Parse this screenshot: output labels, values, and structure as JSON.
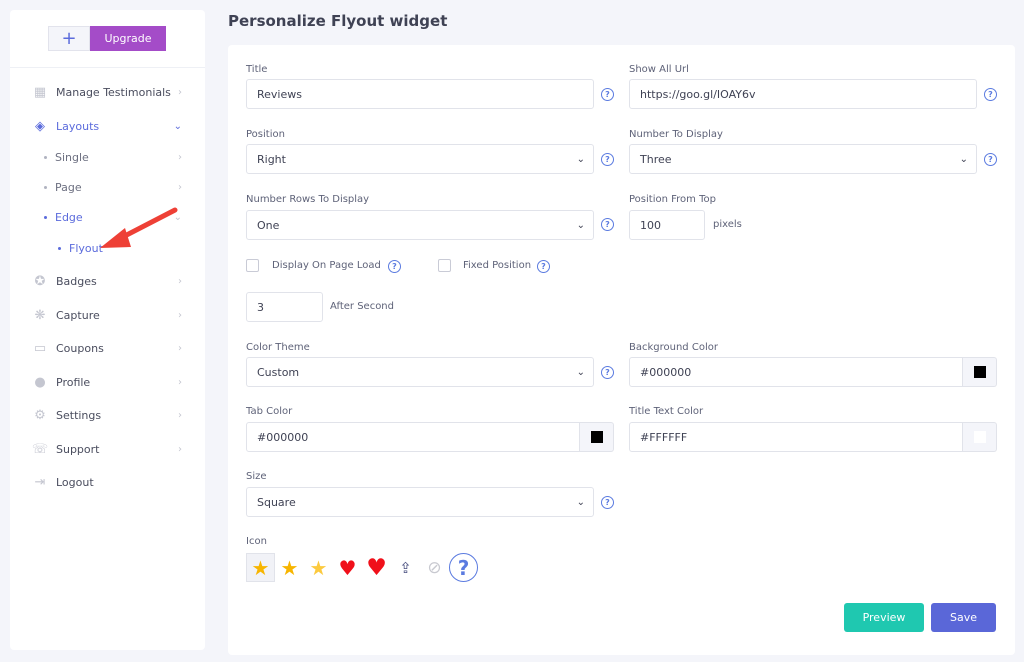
{
  "sidebar": {
    "plus_label": "+",
    "upgrade_label": "Upgrade",
    "items": [
      {
        "label": "Manage Testimonials",
        "icon": "grid-icon"
      },
      {
        "label": "Layouts",
        "icon": "layers-icon"
      },
      {
        "label": "Badges",
        "icon": "badge-icon"
      },
      {
        "label": "Capture",
        "icon": "capture-icon"
      },
      {
        "label": "Coupons",
        "icon": "coupon-icon"
      },
      {
        "label": "Profile",
        "icon": "user-icon"
      },
      {
        "label": "Settings",
        "icon": "gear-icon"
      },
      {
        "label": "Support",
        "icon": "support-icon"
      },
      {
        "label": "Logout",
        "icon": "logout-icon"
      }
    ],
    "subitems": [
      {
        "label": "Single"
      },
      {
        "label": "Page"
      },
      {
        "label": "Edge"
      },
      {
        "label": "Flyout"
      }
    ],
    "accent": "#5b6bdc"
  },
  "page_title": "Personalize Flyout widget",
  "form": {
    "title": {
      "label": "Title",
      "value": "Reviews"
    },
    "show_all_url": {
      "label": "Show All Url",
      "value": "https://goo.gl/IOAY6v"
    },
    "position": {
      "label": "Position",
      "value": "Right"
    },
    "number_to_display": {
      "label": "Number To Display",
      "value": "Three"
    },
    "number_rows": {
      "label": "Number Rows To Display",
      "value": "One"
    },
    "position_from_top": {
      "label": "Position From Top",
      "value": "100",
      "unit": "pixels"
    },
    "display_on_load": {
      "label": "Display On Page Load",
      "checked": false
    },
    "fixed_position": {
      "label": "Fixed Position",
      "checked": false
    },
    "after_second": {
      "value": "3",
      "label": "After Second"
    },
    "color_theme": {
      "label": "Color Theme",
      "value": "Custom"
    },
    "background_color": {
      "label": "Background Color",
      "value": "#000000"
    },
    "tab_color": {
      "label": "Tab Color",
      "value": "#000000"
    },
    "title_text_color": {
      "label": "Title Text Color",
      "value": "#FFFFFF"
    },
    "size": {
      "label": "Size",
      "value": "Square"
    },
    "icon": {
      "label": "Icon",
      "options": [
        "star-icon",
        "star-icon",
        "star-outline-icon",
        "heart-icon",
        "heart-icon",
        "upload-icon",
        "none-icon"
      ],
      "selected": 0
    }
  },
  "buttons": {
    "preview": "Preview",
    "save": "Save",
    "preview_color": "#1fc8b0",
    "save_color": "#5a67d8"
  }
}
